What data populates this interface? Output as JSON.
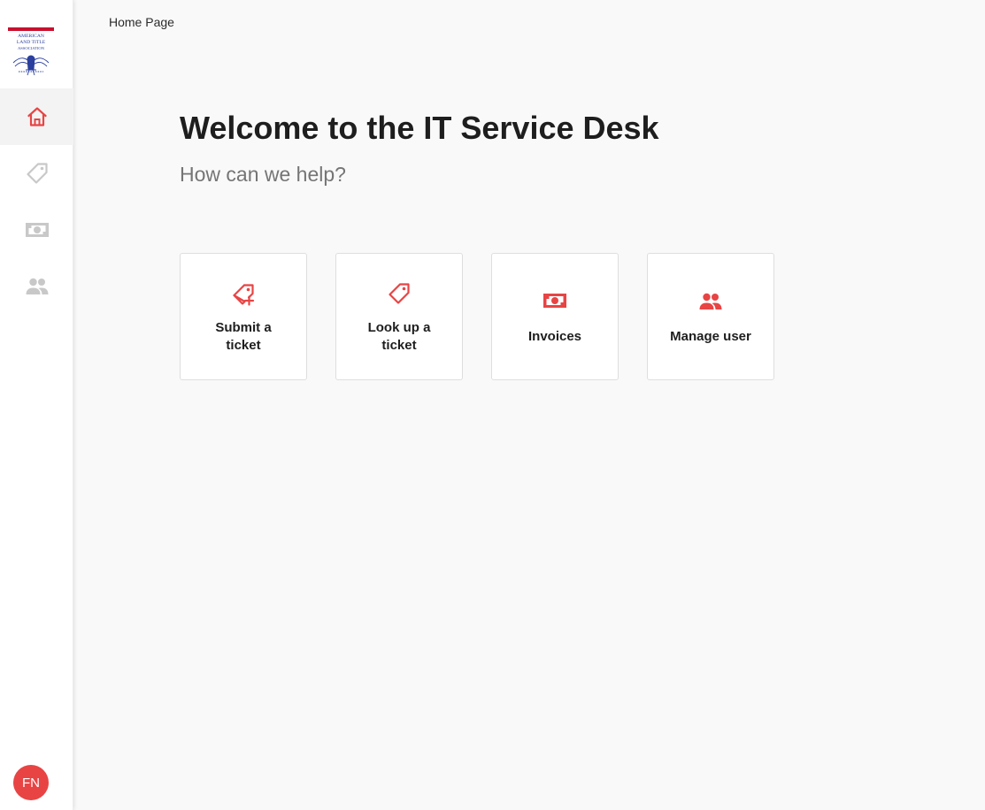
{
  "sidebar": {
    "logo": {
      "lines": [
        "AMERICAN",
        "LAND TITLE",
        "ASSOCIATION"
      ]
    },
    "nav": [
      {
        "id": "home",
        "icon": "home-icon",
        "active": true
      },
      {
        "id": "tickets",
        "icon": "tag-icon",
        "active": false
      },
      {
        "id": "invoices",
        "icon": "money-icon",
        "active": false
      },
      {
        "id": "users",
        "icon": "people-icon",
        "active": false
      }
    ],
    "avatar": {
      "initials": "FN"
    }
  },
  "breadcrumb": {
    "label": "Home Page"
  },
  "hero": {
    "title": "Welcome to the IT Service Desk",
    "subtitle": "How can we help?"
  },
  "cards": [
    {
      "line1": "Submit a",
      "line2": "ticket",
      "icon": "tag-plus-icon"
    },
    {
      "line1": "Look up a",
      "line2": "ticket",
      "icon": "tag-icon"
    },
    {
      "label": "Invoices",
      "icon": "money-icon"
    },
    {
      "label": "Manage user",
      "icon": "people-icon"
    }
  ],
  "colors": {
    "accent": "#e84444",
    "nav_inactive": "#c8c8c8",
    "background": "#f9f9f9",
    "logo_blue": "#2a3f9e",
    "logo_red": "#c8102e"
  }
}
